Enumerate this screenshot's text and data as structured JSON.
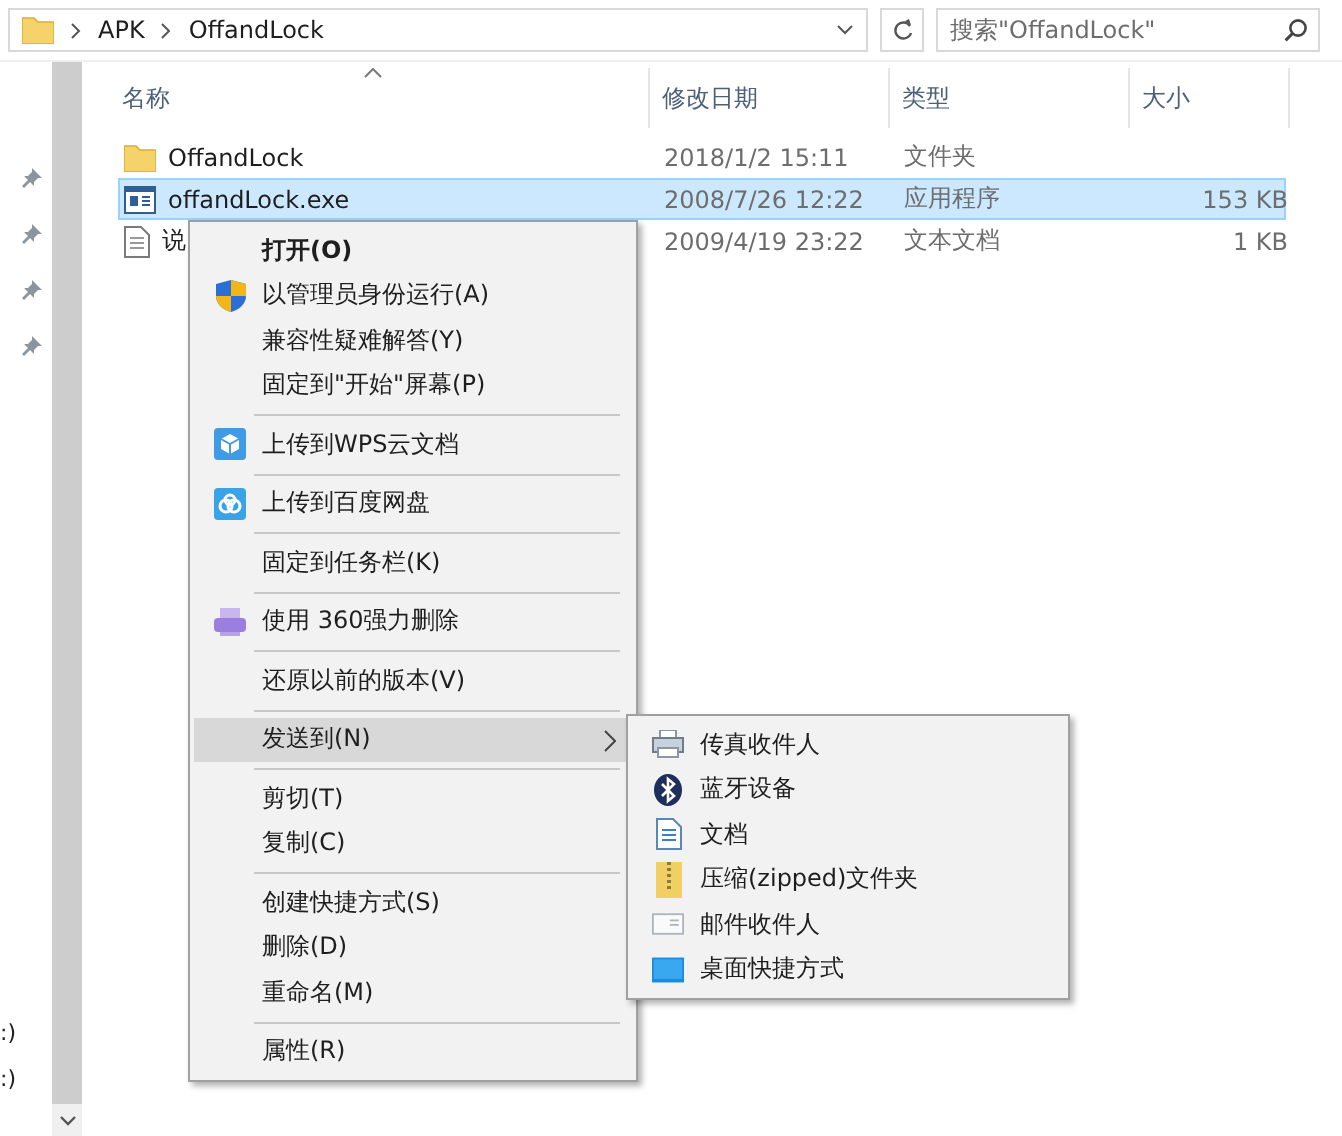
{
  "address_bar": {
    "path": [
      "APK",
      "OffandLock"
    ],
    "search": {
      "placeholder": "搜索\"OffandLock\""
    }
  },
  "navigation": {
    "pins": [
      {
        "pinned": true
      },
      {
        "pinned": true
      },
      {
        "pinned": true
      },
      {
        "pinned": true
      }
    ],
    "drives": [
      ":)",
      ":)"
    ]
  },
  "columns": [
    {
      "label": "名称",
      "sorted": true
    },
    {
      "label": "修改日期",
      "sorted": false
    },
    {
      "label": "类型",
      "sorted": false
    },
    {
      "label": "大小",
      "sorted": false
    }
  ],
  "rows": [
    {
      "kind": "folder",
      "name": "OffandLock",
      "date": "2018/1/2 15:11",
      "type": "文件夹",
      "size": "",
      "selected": false
    },
    {
      "kind": "exe",
      "name": "offandLock.exe",
      "date": "2008/7/26 12:22",
      "type": "应用程序",
      "size": "153 KB",
      "selected": true
    },
    {
      "kind": "text",
      "name": "说",
      "date": "2009/4/19 23:22",
      "type": "文本文档",
      "size": "1 KB",
      "selected": false
    }
  ],
  "context_menu": [
    {
      "kind": "plain",
      "label": "打开(O)",
      "bold": true,
      "selected": false
    },
    {
      "kind": "shield",
      "label": "以管理员身份运行(A)",
      "selected": false
    },
    {
      "kind": "plain",
      "label": "兼容性疑难解答(Y)",
      "selected": false
    },
    {
      "kind": "plain",
      "label": "固定到\"开始\"屏幕(P)",
      "selected": false
    },
    {
      "kind": "separator"
    },
    {
      "kind": "cube",
      "label": "上传到WPS云文档",
      "selected": false
    },
    {
      "kind": "separator"
    },
    {
      "kind": "cloud",
      "label": "上传到百度网盘",
      "selected": false
    },
    {
      "kind": "separator"
    },
    {
      "kind": "plain",
      "label": "固定到任务栏(K)",
      "selected": false
    },
    {
      "kind": "separator"
    },
    {
      "kind": "shredder",
      "label": "使用 360强力删除",
      "selected": false
    },
    {
      "kind": "separator"
    },
    {
      "kind": "plain",
      "label": "还原以前的版本(V)",
      "selected": false
    },
    {
      "kind": "separator"
    },
    {
      "kind": "plain",
      "label": "发送到(N)",
      "submenu": true,
      "selected": true
    },
    {
      "kind": "separator"
    },
    {
      "kind": "plain",
      "label": "剪切(T)",
      "selected": false
    },
    {
      "kind": "plain",
      "label": "复制(C)",
      "selected": false
    },
    {
      "kind": "separator"
    },
    {
      "kind": "plain",
      "label": "创建快捷方式(S)",
      "selected": false
    },
    {
      "kind": "plain",
      "label": "删除(D)",
      "selected": false
    },
    {
      "kind": "plain",
      "label": "重命名(M)",
      "selected": false
    },
    {
      "kind": "separator"
    },
    {
      "kind": "plain",
      "label": "属性(R)",
      "selected": false
    }
  ],
  "send_to_menu": [
    {
      "kind": "fax",
      "label": "传真收件人"
    },
    {
      "kind": "bluetooth",
      "label": "蓝牙设备"
    },
    {
      "kind": "document",
      "label": "文档"
    },
    {
      "kind": "zip",
      "label": "压缩(zipped)文件夹"
    },
    {
      "kind": "mail",
      "label": "邮件收件人"
    },
    {
      "kind": "desktop",
      "label": "桌面快捷方式"
    }
  ]
}
